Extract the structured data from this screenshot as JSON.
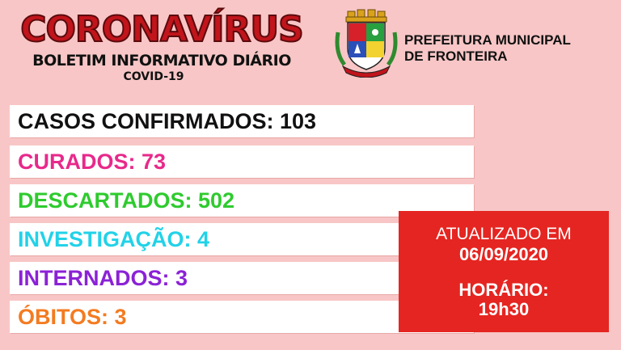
{
  "header": {
    "title": "CORONAVÍRUS",
    "subtitle": "BOLETIM INFORMATIVO DIÁRIO",
    "tag": "COVID-19"
  },
  "prefeitura": {
    "line1": "PREFEITURA MUNICIPAL",
    "line2": "DE FRONTEIRA"
  },
  "stats": {
    "confirmados": "CASOS CONFIRMADOS: 103",
    "curados": "CURADOS: 73",
    "descartados": "DESCARTADOS: 502",
    "investigacao": "INVESTIGAÇÃO: 4",
    "internados": "INTERNADOS: 3",
    "obitos": "ÓBITOS: 3"
  },
  "update": {
    "label": "ATUALIZADO EM",
    "date": "06/09/2020",
    "time_label": "HORÁRIO:",
    "time": "19h30"
  },
  "colors": {
    "background": "#f8c6c6",
    "title": "#c1141b",
    "curados": "#e8298b",
    "descartados": "#2ecb2e",
    "investigacao": "#22d2e8",
    "internados": "#8b22d6",
    "obitos": "#f47b20",
    "update_box": "#e52521"
  }
}
